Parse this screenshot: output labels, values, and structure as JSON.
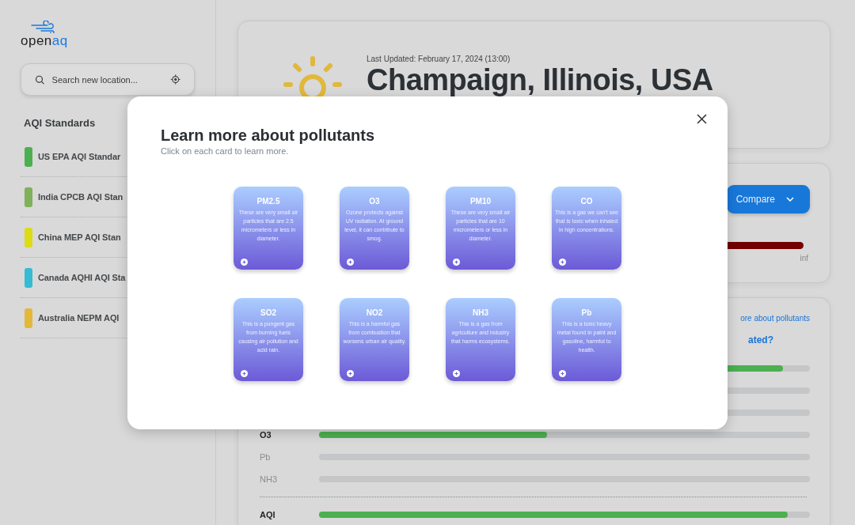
{
  "sidebar": {
    "logo": {
      "part1": "open",
      "part2": "aq"
    },
    "search": {
      "placeholder": "Search new location..."
    },
    "section_title": "AQI Standards",
    "standards": [
      {
        "label": "US EPA AQI Standar",
        "color": "#4caf50"
      },
      {
        "label": "India CPCB AQI Stan",
        "color": "#7fb05a"
      },
      {
        "label": "China MEP AQI Stan",
        "color": "#dcdc14"
      },
      {
        "label": "Canada AQHI AQI Sta",
        "color": "#35bcd4"
      },
      {
        "label": "Australia NEPM AQI",
        "color": "#e3b83a"
      }
    ]
  },
  "location_card": {
    "last_updated": "Last Updated: February 17, 2024 (13:00)",
    "title": "Champaign, Illinois, USA"
  },
  "compare_card": {
    "button": "Compare",
    "scale_end": "inf"
  },
  "pollutant_card": {
    "link": "ore about pollutants",
    "heading": "ated?",
    "rows": [
      {
        "level": 0.945
      },
      {},
      {},
      {
        "label": "O3",
        "level": 0.465,
        "active": true
      },
      {
        "label": "Pb",
        "active": false
      },
      {
        "label": "NH3",
        "active": false
      }
    ],
    "aqi": {
      "label": "AQI",
      "level": 0.955
    }
  },
  "modal": {
    "title": "Learn more about pollutants",
    "subtitle": "Click on each card to learn more.",
    "cards": [
      {
        "name": "PM2.5",
        "text": "These are very small air particles that are 2.5 micrometers or less in diameter."
      },
      {
        "name": "O3",
        "text": "Ozone protects against UV radiation. At ground level, it can contribute to smog."
      },
      {
        "name": "PM10",
        "text": "These are very small air particles that are 10 micrometers or less in diameter."
      },
      {
        "name": "CO",
        "text": "This is a gas we can't see that is toxic when inhaled in high concentrations."
      },
      {
        "name": "SO2",
        "text": "This is a pungent gas from burning fuels causing air pollution and acid rain."
      },
      {
        "name": "NO2",
        "text": "This is a harmful gas from combustion that worsens urban air quality."
      },
      {
        "name": "NH3",
        "text": "This is a gas from agriculture and industry that harms ecosystems."
      },
      {
        "name": "Pb",
        "text": "This is a toxic heavy metal found in paint and gasoline, harmful to health."
      }
    ]
  }
}
